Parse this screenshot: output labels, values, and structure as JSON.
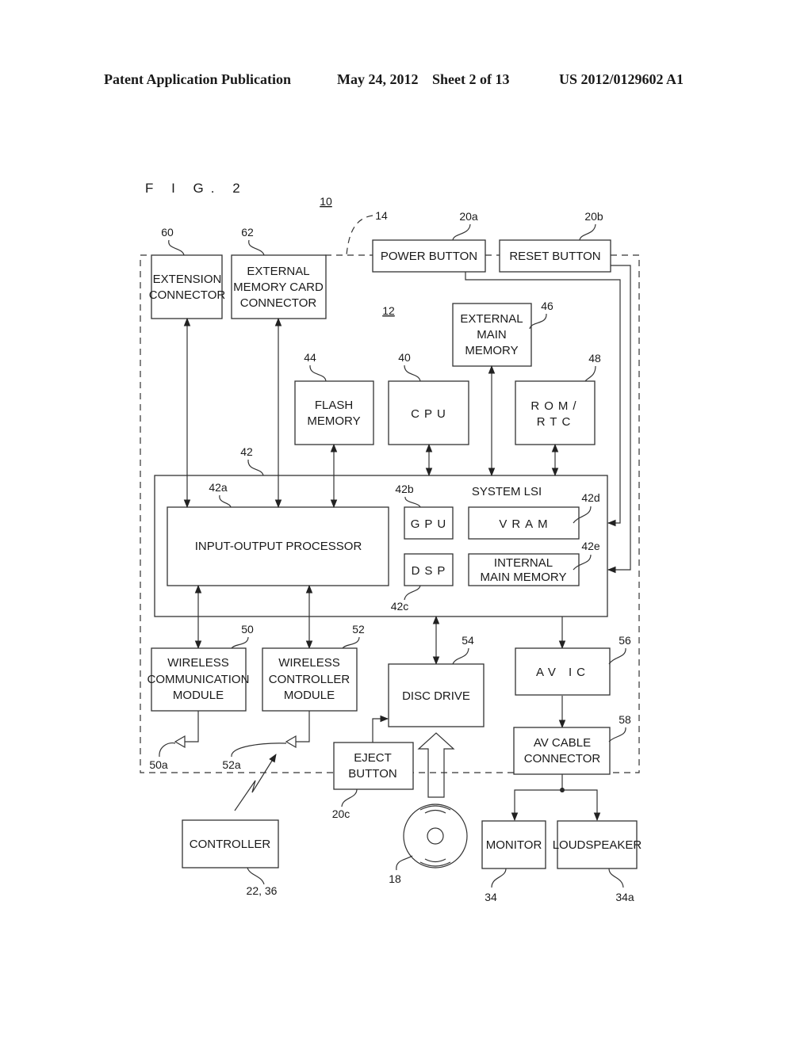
{
  "header": {
    "publication": "Patent Application Publication",
    "date": "May 24, 2012",
    "sheet": "Sheet 2 of 13",
    "number": "US 2012/0129602 A1"
  },
  "figure": {
    "title": "F I G. 2",
    "refs": {
      "device": "10",
      "housing": "14",
      "board": "12"
    },
    "blocks": {
      "extension_connector": {
        "ref": "60",
        "lines": [
          "EXTENSION",
          "CONNECTOR"
        ]
      },
      "external_memory_card_connector": {
        "ref": "62",
        "lines": [
          "EXTERNAL",
          "MEMORY CARD",
          "CONNECTOR"
        ]
      },
      "power_button": {
        "ref": "20a",
        "lines": [
          "POWER BUTTON"
        ]
      },
      "reset_button": {
        "ref": "20b",
        "lines": [
          "RESET BUTTON"
        ]
      },
      "external_main_memory": {
        "ref": "46",
        "lines": [
          "EXTERNAL",
          "MAIN",
          "MEMORY"
        ]
      },
      "flash_memory": {
        "ref": "44",
        "lines": [
          "FLASH",
          "MEMORY"
        ]
      },
      "cpu": {
        "ref": "40",
        "lines": [
          "CPU"
        ]
      },
      "rom_rtc": {
        "ref": "48",
        "lines": [
          "ROM/",
          "RTC"
        ]
      },
      "system_lsi": {
        "ref": "42",
        "lines": [
          "SYSTEM LSI"
        ]
      },
      "input_output_processor": {
        "ref": "42a",
        "lines": [
          "INPUT-OUTPUT PROCESSOR"
        ]
      },
      "gpu": {
        "ref": "42b",
        "lines": [
          "GPU"
        ]
      },
      "dsp": {
        "ref": "42c",
        "lines": [
          "DSP"
        ]
      },
      "vram": {
        "ref": "42d",
        "lines": [
          "VRAM"
        ]
      },
      "internal_main_memory": {
        "ref": "42e",
        "lines": [
          "INTERNAL",
          "MAIN MEMORY"
        ]
      },
      "wireless_communication_module": {
        "ref": "50",
        "lines": [
          "WIRELESS",
          "COMMUNICATION",
          "MODULE"
        ]
      },
      "wireless_controller_module": {
        "ref": "52",
        "lines": [
          "WIRELESS",
          "CONTROLLER",
          "MODULE"
        ]
      },
      "disc_drive": {
        "ref": "54",
        "lines": [
          "DISC DRIVE"
        ]
      },
      "av_ic": {
        "ref": "56",
        "lines": [
          "AV  IC"
        ]
      },
      "av_cable_connector": {
        "ref": "58",
        "lines": [
          "AV CABLE",
          "CONNECTOR"
        ]
      },
      "eject_button": {
        "ref": "20c",
        "lines": [
          "EJECT",
          "BUTTON"
        ]
      },
      "controller": {
        "ref": "22, 36",
        "lines": [
          "CONTROLLER"
        ]
      },
      "monitor": {
        "ref": "34",
        "lines": [
          "MONITOR"
        ]
      },
      "loudspeaker": {
        "ref": "34a",
        "lines": [
          "LOUDSPEAKER"
        ]
      }
    },
    "antennas": {
      "a50": "50a",
      "a52": "52a"
    },
    "disc": {
      "ref": "18"
    }
  }
}
